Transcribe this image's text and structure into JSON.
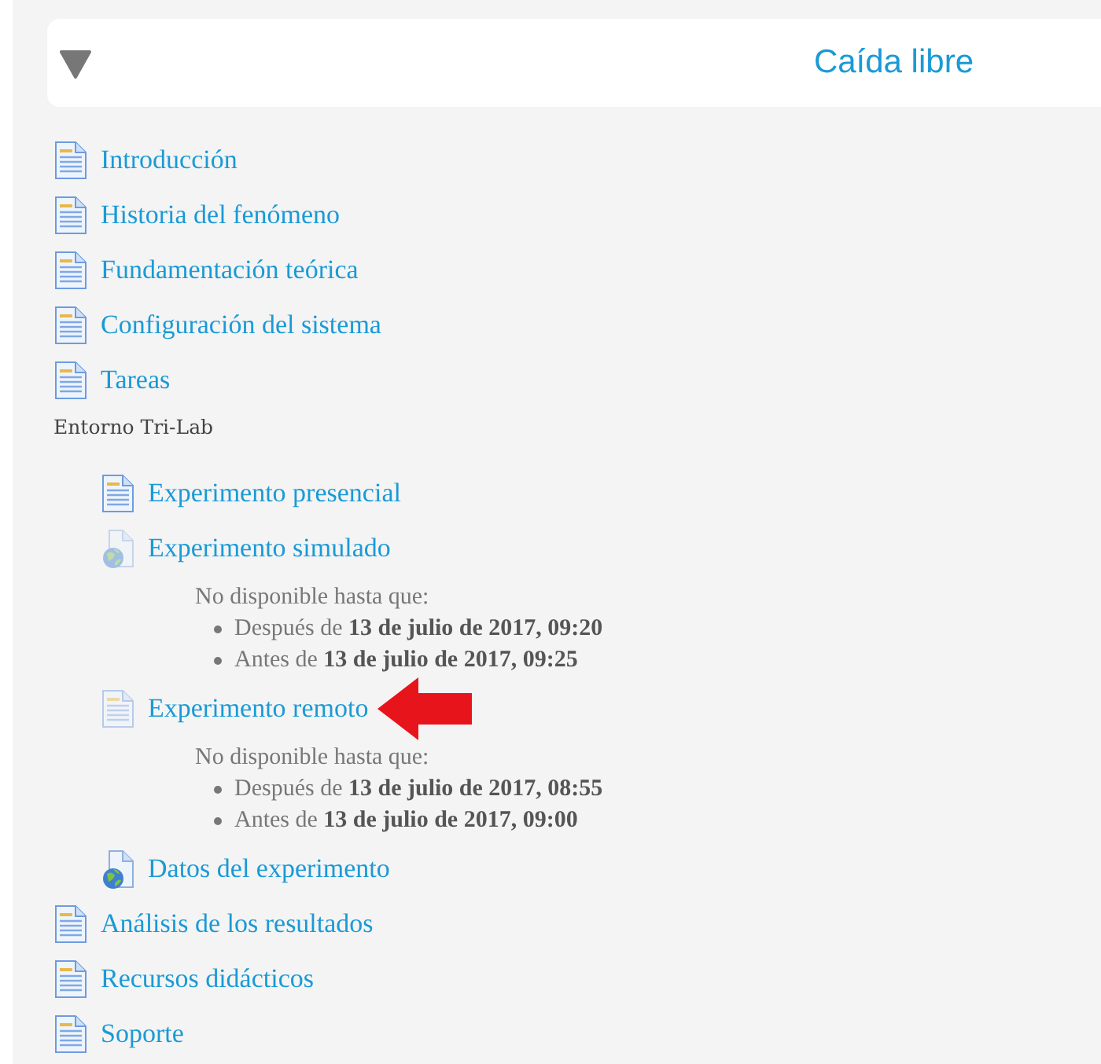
{
  "section": {
    "title": "Caída libre",
    "expanded": true
  },
  "items": [
    {
      "kind": "page",
      "label": "Introducción",
      "dimmed": false
    },
    {
      "kind": "page",
      "label": "Historia del fenómeno",
      "dimmed": false
    },
    {
      "kind": "page",
      "label": "Fundamentación teórica",
      "dimmed": false
    },
    {
      "kind": "page",
      "label": "Configuración del sistema",
      "dimmed": false
    },
    {
      "kind": "page",
      "label": "Tareas",
      "dimmed": false
    },
    {
      "kind": "label",
      "label": "Entorno Tri-Lab",
      "children": [
        {
          "kind": "page",
          "label": "Experimento presencial",
          "dimmed": false
        },
        {
          "kind": "url",
          "label": "Experimento simulado",
          "dimmed": true,
          "restriction": {
            "heading": "No disponible hasta que:",
            "conditions": [
              "Después de **13 de julio de 2017, 09:20**",
              "Antes de **13 de julio de 2017, 09:25**"
            ]
          }
        },
        {
          "kind": "page",
          "label": "Experimento remoto",
          "dimmed": true,
          "pointed_at": true,
          "restriction": {
            "heading": "No disponible hasta que:",
            "conditions": [
              "Después de **13 de julio de 2017, 08:55**",
              "Antes de **13 de julio de 2017, 09:00**"
            ]
          }
        },
        {
          "kind": "url",
          "label": "Datos del experimento",
          "dimmed": false
        }
      ]
    },
    {
      "kind": "page",
      "label": "Análisis de los resultados",
      "dimmed": false
    },
    {
      "kind": "page",
      "label": "Recursos didácticos",
      "dimmed": false
    },
    {
      "kind": "page",
      "label": "Soporte",
      "dimmed": false
    }
  ]
}
